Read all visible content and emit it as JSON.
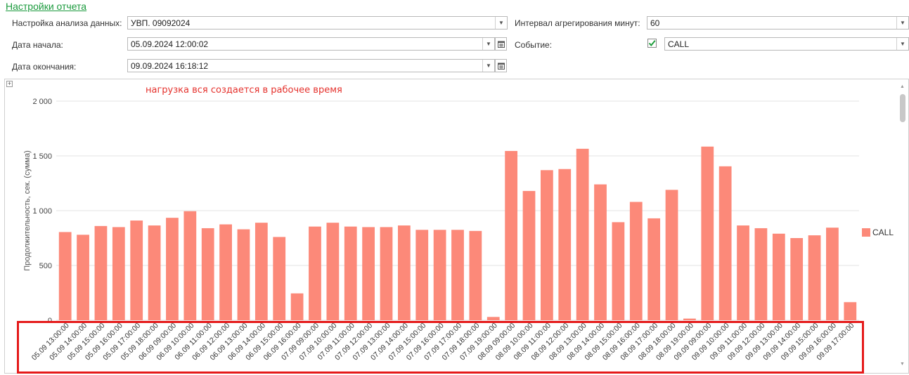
{
  "settings": {
    "title": "Настройки отчета",
    "analysis_label": "Настройка анализа данных:",
    "analysis_value": "УВП. 09092024",
    "start_label": "Дата начала:",
    "start_value": "05.09.2024 12:00:02",
    "end_label": "Дата окончания:",
    "end_value": "09.09.2024 16:18:12",
    "interval_label": "Интервал агрегирования минут:",
    "interval_value": "60",
    "event_label": "Событие:",
    "event_checked": true,
    "event_value": "CALL"
  },
  "annotation": "нагрузка вся создается в рабочее время",
  "colors": {
    "bar": "#fc8979",
    "check": "#1e9e3c",
    "link": "#1a9a3c",
    "annotation": "#e5322d",
    "highlight": "#e51a1a"
  },
  "chart_data": {
    "type": "bar",
    "ylabel": "Продолжительность, сек. (сумма)",
    "ylim": [
      0,
      2000
    ],
    "yticks": [
      0,
      500,
      1000,
      1500,
      2000
    ],
    "ytick_labels": [
      "0",
      "500",
      "1 000",
      "1 500",
      "2 000"
    ],
    "grid": true,
    "legend": "right",
    "categories": [
      "05.09 13:00:00",
      "05.09 14:00:00",
      "05.09 15:00:00",
      "05.09 16:00:00",
      "05.09 17:00:00",
      "05.09 18:00:00",
      "06.09 09:00:00",
      "06.09 10:00:00",
      "06.09 11:00:00",
      "06.09 12:00:00",
      "06.09 13:00:00",
      "06.09 14:00:00",
      "06.09 15:00:00",
      "06.09 16:00:00",
      "07.09 09:00:00",
      "07.09 10:00:00",
      "07.09 11:00:00",
      "07.09 12:00:00",
      "07.09 13:00:00",
      "07.09 14:00:00",
      "07.09 15:00:00",
      "07.09 16:00:00",
      "07.09 17:00:00",
      "07.09 18:00:00",
      "07.09 19:00:00",
      "08.09 09:00:00",
      "08.09 10:00:00",
      "08.09 11:00:00",
      "08.09 12:00:00",
      "08.09 13:00:00",
      "08.09 14:00:00",
      "08.09 15:00:00",
      "08.09 16:00:00",
      "08.09 17:00:00",
      "08.09 18:00:00",
      "08.09 19:00:00",
      "09.09 09:00:00",
      "09.09 10:00:00",
      "09.09 11:00:00",
      "09.09 12:00:00",
      "09.09 13:00:00",
      "09.09 14:00:00",
      "09.09 15:00:00",
      "09.09 16:00:00",
      "09.09 17:00:00"
    ],
    "series": [
      {
        "name": "CALL",
        "values": [
          805,
          780,
          860,
          850,
          910,
          865,
          935,
          995,
          840,
          875,
          830,
          890,
          760,
          245,
          855,
          890,
          855,
          850,
          850,
          865,
          825,
          825,
          825,
          815,
          30,
          1545,
          1180,
          1370,
          1380,
          1565,
          1240,
          895,
          1080,
          930,
          1190,
          15,
          1585,
          1405,
          865,
          840,
          790,
          750,
          775,
          845,
          165
        ]
      }
    ]
  }
}
